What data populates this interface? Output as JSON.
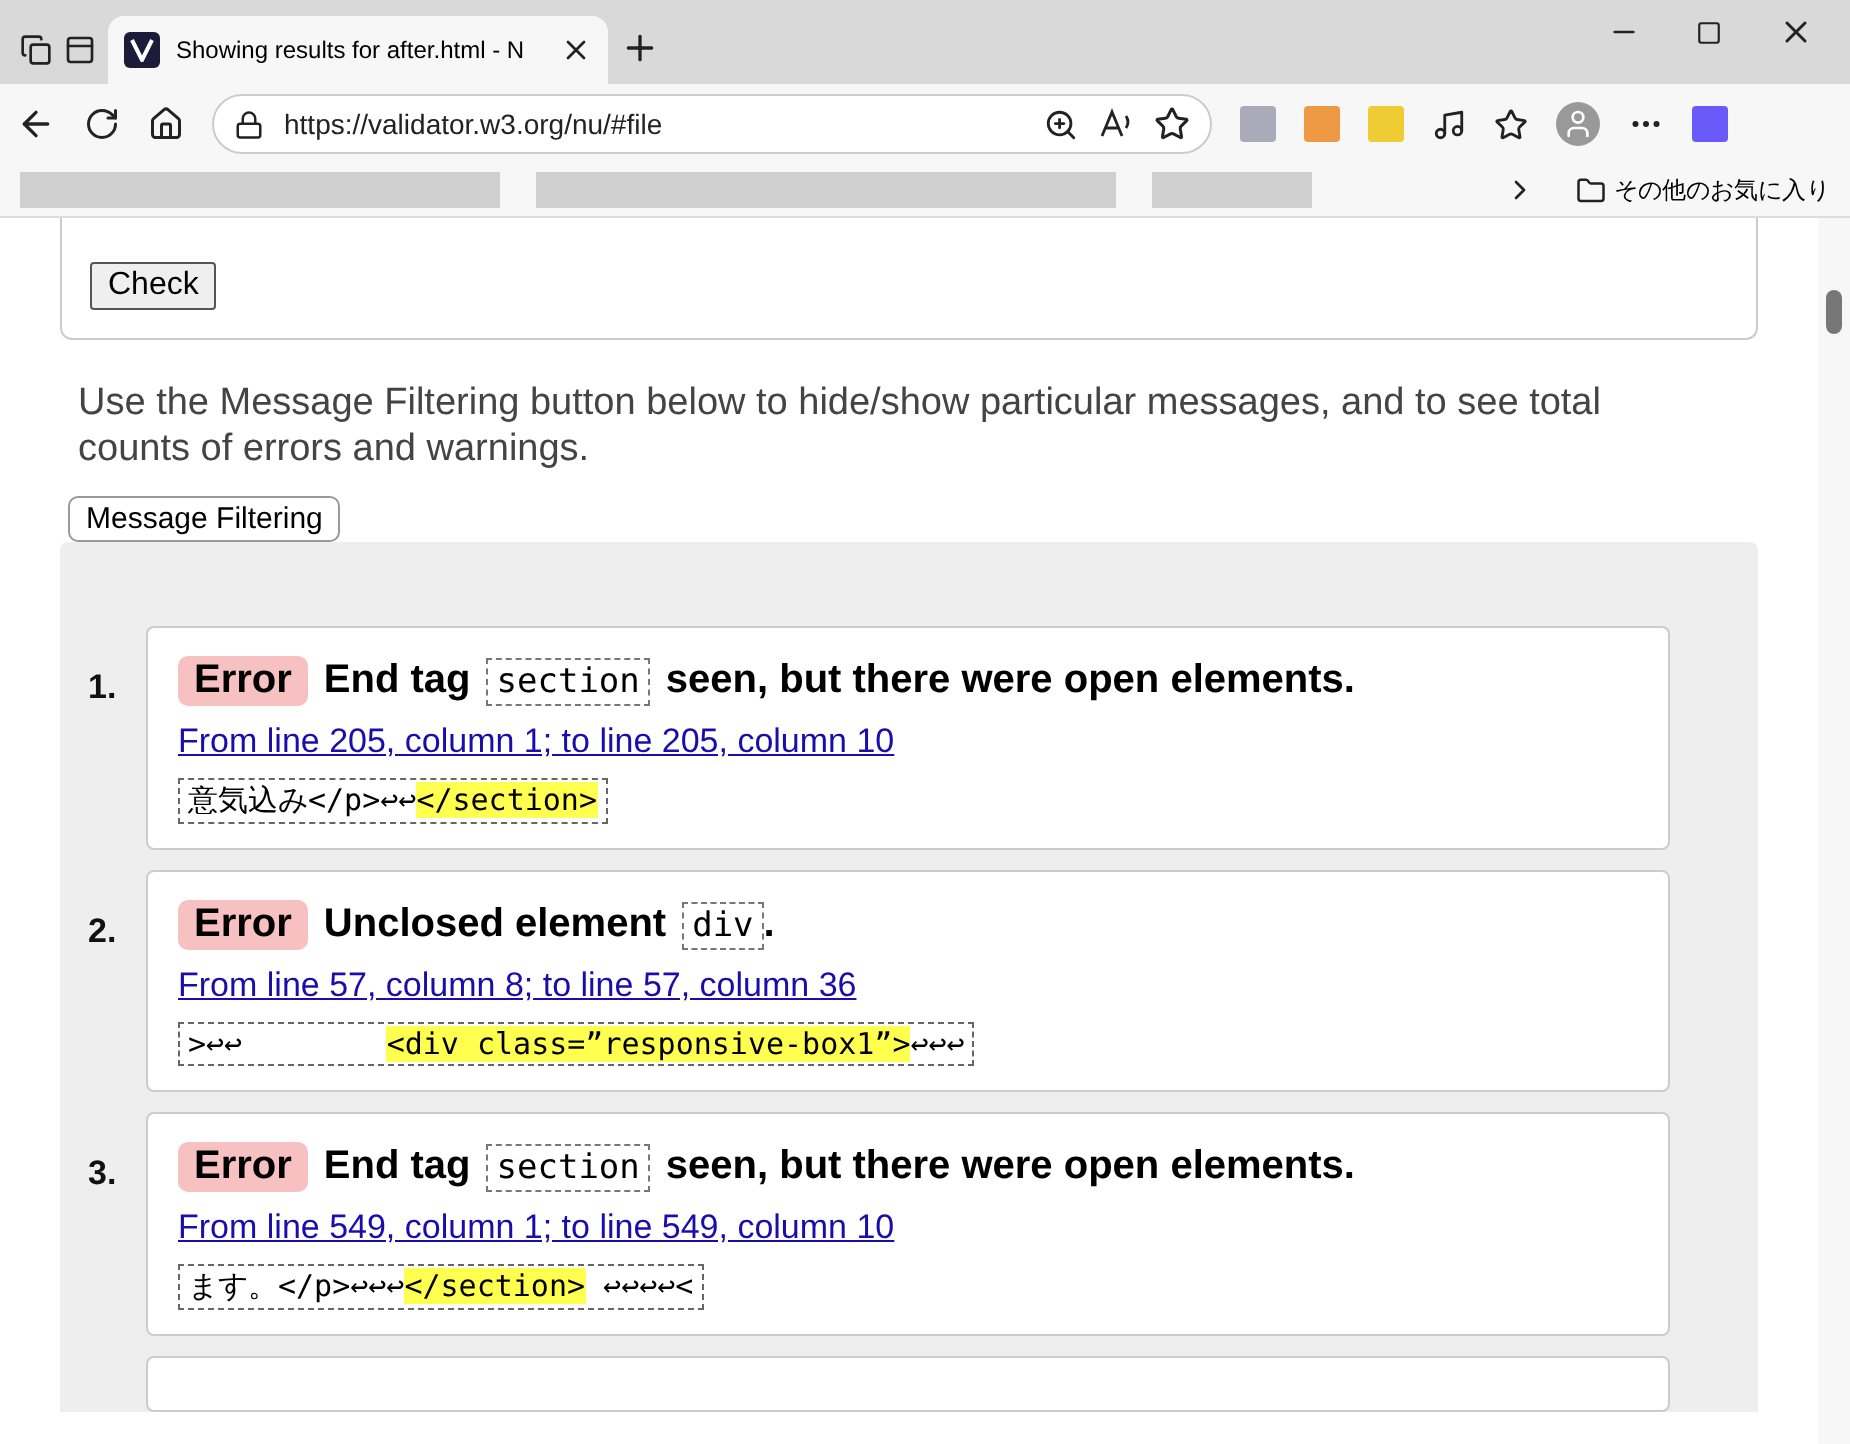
{
  "browser": {
    "tab_title": "Showing results for after.html - N",
    "url": "https://validator.w3.org/nu/#file",
    "other_favorites": "その他のお気に入り"
  },
  "form": {
    "check_button": "Check"
  },
  "intro": "Use the Message Filtering button below to hide/show particular messages, and to see total counts of errors and warnings.",
  "filter_button": "Message Filtering",
  "messages": [
    {
      "number": "1.",
      "kind": "error",
      "type_label": "Error",
      "text_before": "End tag",
      "code": "section",
      "text_after": "seen, but there were open elements.",
      "location": "From line 205, column 1; to line 205, column 10",
      "extract_before": "意気込み</p>↩↩",
      "extract_highlight": "</section>"
    },
    {
      "number": "2.",
      "kind": "error",
      "type_label": "Error",
      "text_before": "Unclosed element",
      "code": "div",
      "text_after": ".",
      "location": "From line 57, column 8; to line 57, column 36",
      "extract_before": ">↩↩        ",
      "extract_highlight": "<div class=”responsive-box1”>",
      "extract_after": "↩↩↩"
    },
    {
      "number": "3.",
      "kind": "error",
      "type_label": "Error",
      "text_before": "End tag",
      "code": "section",
      "text_after": "seen, but there were open elements.",
      "location": "From line 549, column 1; to line 549, column 10",
      "extract_before": "ます。</p>↩↩↩",
      "extract_highlight": "</section>",
      "extract_after": " ↩↩↩↩<"
    }
  ]
}
